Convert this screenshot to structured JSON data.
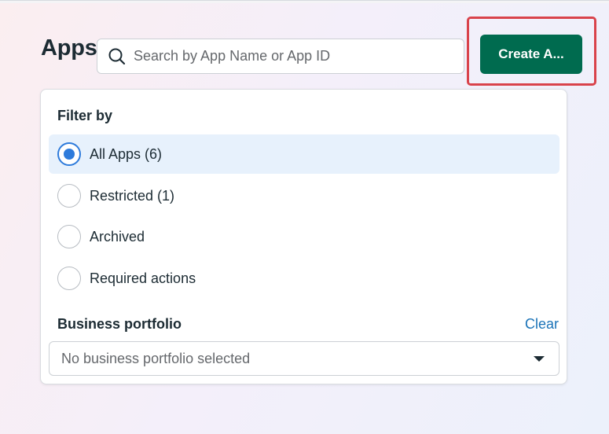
{
  "header": {
    "title": "Apps",
    "search_placeholder": "Search by App Name or App ID",
    "create_button_label": "Create A..."
  },
  "filter": {
    "heading": "Filter by",
    "options": [
      {
        "label": "All Apps (6)",
        "selected": true
      },
      {
        "label": "Restricted (1)",
        "selected": false
      },
      {
        "label": "Archived",
        "selected": false
      },
      {
        "label": "Required actions",
        "selected": false
      }
    ]
  },
  "business_portfolio": {
    "heading": "Business portfolio",
    "clear_label": "Clear",
    "selected_value": "No business portfolio selected"
  },
  "icons": {
    "search": "search-icon",
    "dropdown": "caret-down-icon"
  },
  "colors": {
    "primary_button": "#006b4f",
    "highlight_border": "#d9434b",
    "radio_selected": "#2e7bdb",
    "selected_row": "#e7f1fc",
    "link": "#1a73b8"
  }
}
